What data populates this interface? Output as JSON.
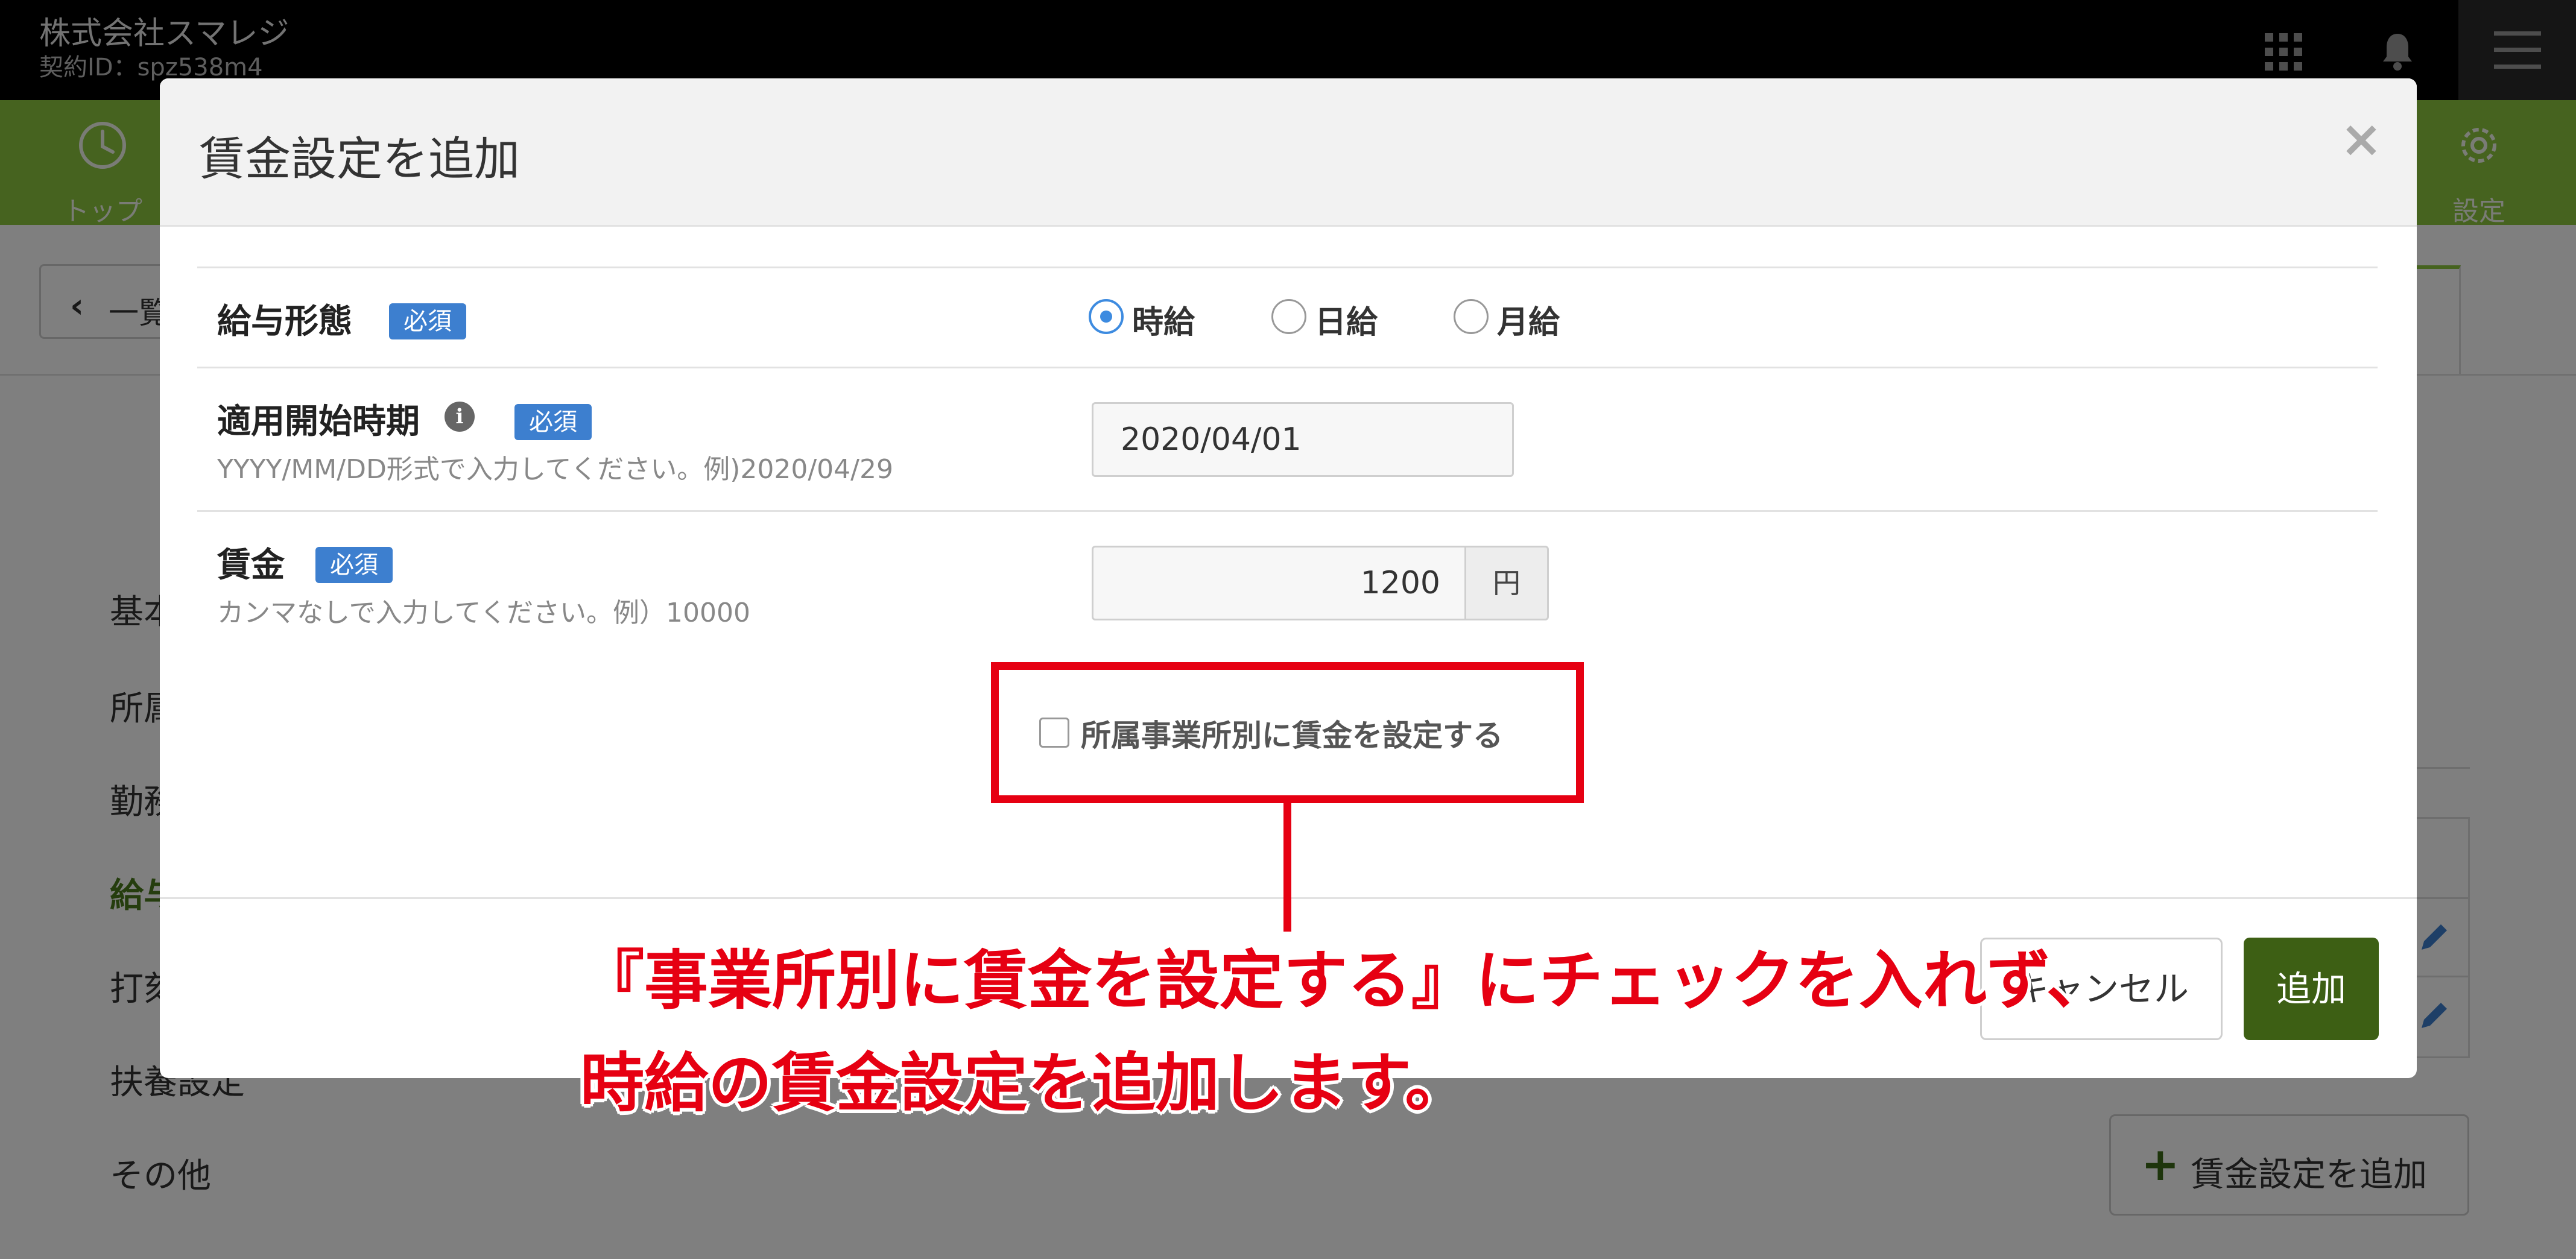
{
  "header": {
    "company_name": "株式会社スマレジ",
    "contract_id": "契約ID：spz538m4"
  },
  "nav": {
    "top_label": "トップ",
    "settings_label": "設定"
  },
  "background": {
    "back_label": "一覧",
    "sidebar_items": [
      {
        "label": "基本"
      },
      {
        "label": "所属"
      },
      {
        "label": "勤務"
      },
      {
        "label": "給与"
      },
      {
        "label": "打刻"
      },
      {
        "label": "扶養設定"
      },
      {
        "label": "その他"
      }
    ],
    "add_wage_button_label": "賃金設定を追加"
  },
  "modal": {
    "title": "賃金設定を追加",
    "close_symbol": "×",
    "required_badge": "必須",
    "pay_type": {
      "label": "給与形態",
      "options": [
        {
          "label": "時給",
          "checked": true
        },
        {
          "label": "日給",
          "checked": false
        },
        {
          "label": "月給",
          "checked": false
        }
      ]
    },
    "start_date": {
      "label": "適用開始時期",
      "hint": "YYYY/MM/DD形式で入力してください。例)2020/04/29",
      "value": "2020/04/01"
    },
    "wage": {
      "label": "賃金",
      "hint": "カンマなしで入力してください。例）10000",
      "value": "1200",
      "unit": "円"
    },
    "per_office_checkbox": {
      "label": "所属事業所別に賃金を設定する",
      "checked": false
    },
    "cancel_label": "キャンセル",
    "add_label": "追加"
  },
  "annotation": {
    "line1": "『事業所別に賃金を設定する』にチェックを入れず、",
    "line2": "時給の賃金設定を追加します。",
    "color": "#e60012"
  }
}
